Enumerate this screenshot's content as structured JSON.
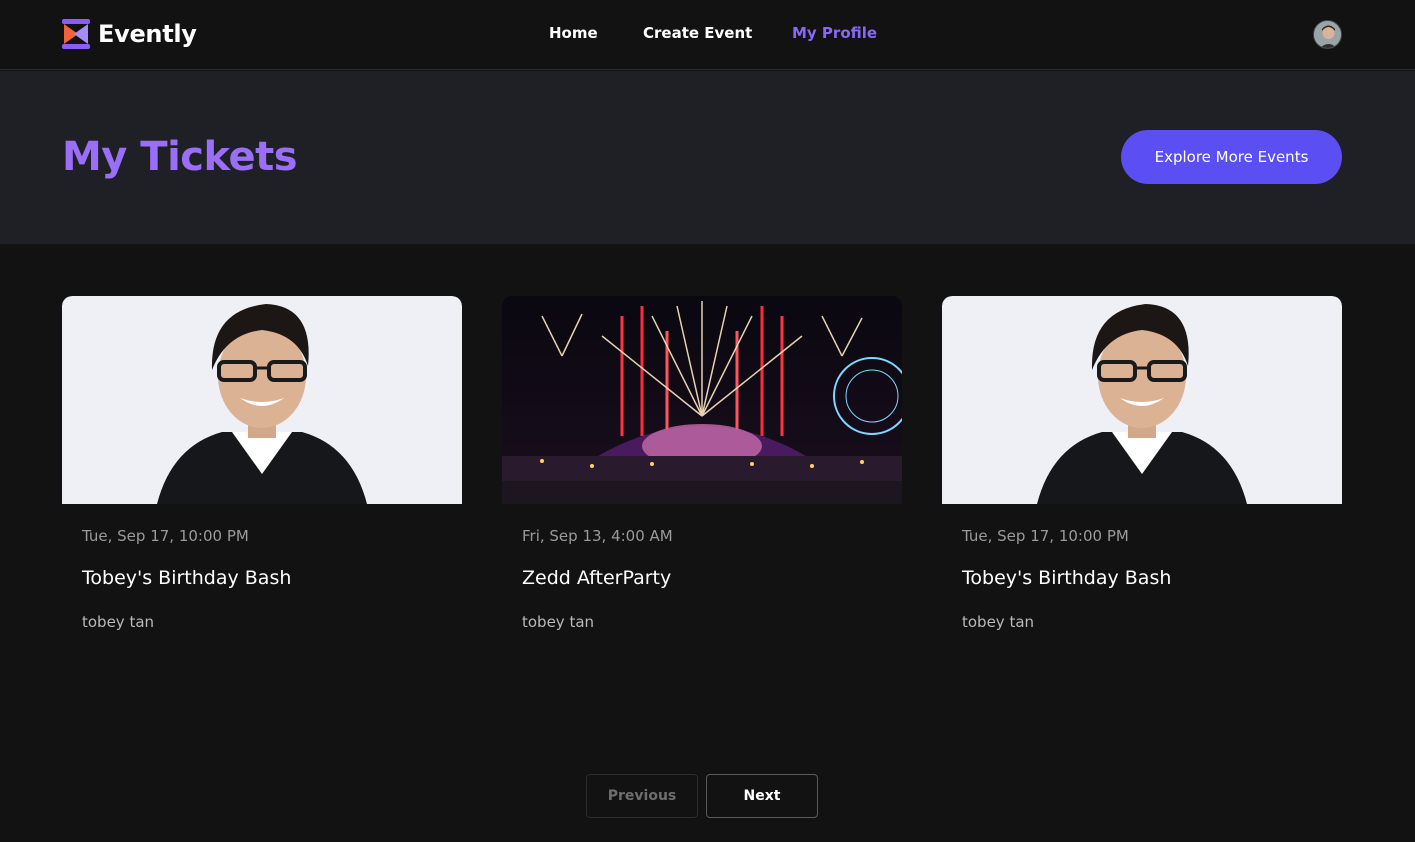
{
  "app": {
    "name": "Evently"
  },
  "nav": {
    "items": [
      {
        "label": "Home",
        "active": false
      },
      {
        "label": "Create Event",
        "active": false
      },
      {
        "label": "My Profile",
        "active": true
      }
    ]
  },
  "banner": {
    "title": "My Tickets",
    "explore_label": "Explore More Events"
  },
  "cards": [
    {
      "date": "Tue, Sep 17, 10:00 PM",
      "title": "Tobey's Birthday Bash",
      "organizer": "tobey tan",
      "image": "portrait-photo"
    },
    {
      "date": "Fri, Sep 13, 4:00 AM",
      "title": "Zedd AfterParty",
      "organizer": "tobey tan",
      "image": "fireworks-festival-photo"
    },
    {
      "date": "Tue, Sep 17, 10:00 PM",
      "title": "Tobey's Birthday Bash",
      "organizer": "tobey tan",
      "image": "portrait-photo"
    }
  ],
  "pagination": {
    "previous_label": "Previous",
    "next_label": "Next",
    "previous_disabled": true
  },
  "colors": {
    "background": "#121212",
    "banner": "#1f2025",
    "accent": "#9b6ef7",
    "button": "#5b4ef2",
    "nav_active": "#8a67f7"
  }
}
